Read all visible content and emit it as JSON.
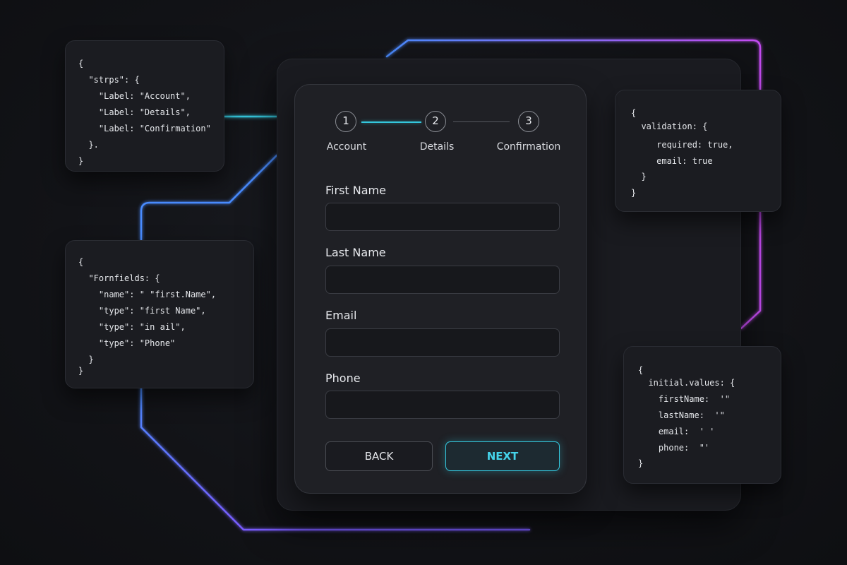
{
  "colors": {
    "accent_cyan": "#34c6dc",
    "accent_blue": "#4a8cff",
    "accent_violet": "#7a5cff",
    "accent_magenta": "#c44cf0",
    "background": "#121317"
  },
  "steps": [
    {
      "number": "1",
      "label": "Account"
    },
    {
      "number": "2",
      "label": "Details"
    },
    {
      "number": "3",
      "label": "Confirmation"
    }
  ],
  "fields": [
    {
      "label": "First Name",
      "value": ""
    },
    {
      "label": "Last Name",
      "value": ""
    },
    {
      "label": "Email",
      "value": ""
    },
    {
      "label": "Phone",
      "value": ""
    }
  ],
  "buttons": {
    "back": "BACK",
    "next": "NEXT"
  },
  "code": {
    "steps": [
      "{",
      "  \"strps\": {",
      "    \"Label: \"Account\",",
      "    \"Label: \"Details\",",
      "    \"Label: \"Confirmation\"",
      "  }.",
      "}"
    ],
    "fields": [
      "{",
      "  \"Fornfields: {",
      "    \"name\": \" \"first.Name\",",
      "    \"type\": \"first Name\",",
      "    \"type\": \"in ail\",",
      "    \"type\": \"Phone\"",
      "  }",
      "}"
    ],
    "validation": [
      "{",
      "  validation: {",
      "     required: true,",
      "     email: true",
      "  }",
      "}"
    ],
    "initial": [
      "{",
      "  initial.values: {",
      "    firstName:  '\"",
      "    lastName:  '\"",
      "    email:  ' '",
      "    phone:  \"'",
      "}"
    ]
  }
}
